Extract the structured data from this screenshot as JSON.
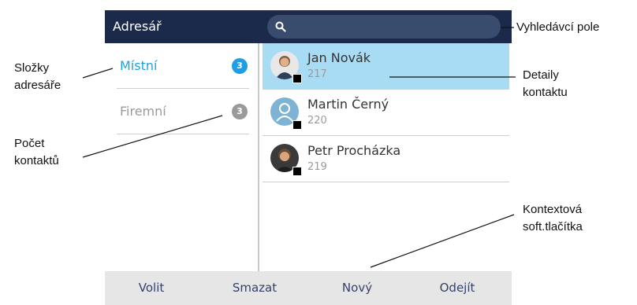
{
  "header": {
    "title": "Adresář"
  },
  "search": {
    "icon": "search-icon"
  },
  "folders": [
    {
      "label": "Místní",
      "count": "3"
    },
    {
      "label": "Firemní",
      "count": "3"
    }
  ],
  "contacts": [
    {
      "name": "Jan Novák",
      "number": "217",
      "avatar": "photo-avatar",
      "presence": "unknown"
    },
    {
      "name": "Martin Černý",
      "number": "220",
      "avatar": "generic-user-icon",
      "presence": "unknown"
    },
    {
      "name": "Petr Procházka",
      "number": "219",
      "avatar": "photo-avatar",
      "presence": "unknown"
    }
  ],
  "softkeys": [
    "Volit",
    "Smazat",
    "Nový",
    "Odejít"
  ],
  "callouts": {
    "search_field": "Vyhledávcí pole",
    "folders_line1": "Složky",
    "folders_line2": "adresáře",
    "count_line1": "Počet",
    "count_line2": "kontaktů",
    "details_line1": "Detaily",
    "details_line2": "kontaktu",
    "softkeys_line1": "Kontextová",
    "softkeys_line2": "soft.tlačítka"
  },
  "colors": {
    "header_bg": "#1b2a4a",
    "accent": "#1fa0e0",
    "selected_row": "#a8dcf5",
    "softkey_bar": "#e6e6e6"
  }
}
